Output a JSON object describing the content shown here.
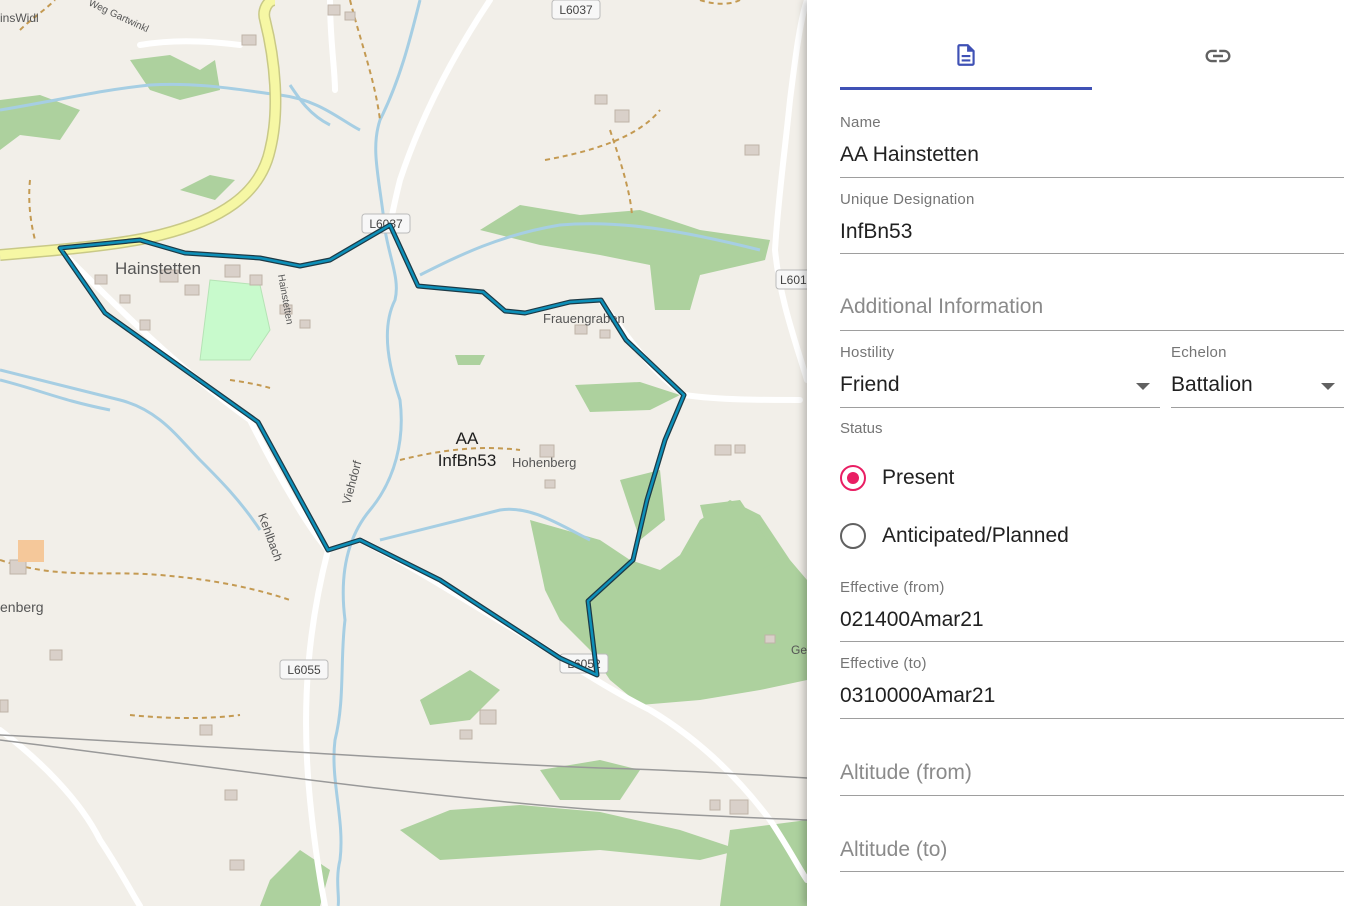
{
  "map": {
    "labels": {
      "l6037_top": "L6037",
      "l6037_mid": "L6037",
      "l601": "L601",
      "l6055": "L6055",
      "l6052": "L6052",
      "hainstetten": "Hainstetten",
      "frauengraben": "Frauengraben",
      "hohenberg": "Hohenberg",
      "kehlbach": "Kehlbach",
      "viehdorf": "Viehdorf",
      "hainstetten_street": "Hainstetten",
      "weg_gartwinkl": "Weg Gartwinkl",
      "einswidl": "insWidl",
      "enberg": "enberg",
      "ge": "Ge"
    },
    "area_name": "AA",
    "area_designation": "InfBn53",
    "colors": {
      "outline": "#0d8fb8",
      "forest": "#a8d29a",
      "water": "#a6cee3",
      "highway": "#f5f5a0"
    }
  },
  "panel": {
    "tabs": [
      {
        "icon": "document-icon",
        "active": true
      },
      {
        "icon": "link-icon",
        "active": false
      }
    ],
    "name": {
      "label": "Name",
      "value": "AA Hainstetten"
    },
    "designation": {
      "label": "Unique Designation",
      "value": "InfBn53"
    },
    "additional": {
      "placeholder": "Additional Information"
    },
    "hostility": {
      "label": "Hostility",
      "value": "Friend"
    },
    "echelon": {
      "label": "Echelon",
      "value": "Battalion"
    },
    "status": {
      "label": "Status",
      "options": [
        {
          "label": "Present",
          "selected": true
        },
        {
          "label": "Anticipated/Planned",
          "selected": false
        }
      ]
    },
    "effective_from": {
      "label": "Effective (from)",
      "value": "021400Amar21"
    },
    "effective_to": {
      "label": "Effective (to)",
      "value": "0310000Amar21"
    },
    "altitude_from": {
      "placeholder": "Altitude (from)"
    },
    "altitude_to": {
      "placeholder": "Altitude (to)"
    },
    "accent_color": "#3f51b5",
    "radio_color": "#e91e63"
  }
}
